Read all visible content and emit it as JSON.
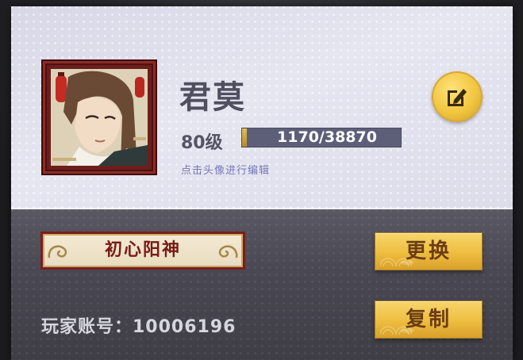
{
  "player": {
    "name": "君莫",
    "level_label": "80级",
    "xp_text": "1170/38870",
    "xp_fraction": 0.0301,
    "avatar_hint": "点击头像进行编辑"
  },
  "title_plate": {
    "text": "初心阳神"
  },
  "buttons": {
    "change_label": "更换",
    "copy_label": "复制"
  },
  "account": {
    "label": "玩家账号：10006196"
  },
  "icons": {
    "edit": "edit-pencil-icon"
  },
  "colors": {
    "gold": "#efc042",
    "title_red": "#7a1a16",
    "name_text": "#4f4f60",
    "xp_bar_bg": "#5d5f78"
  }
}
